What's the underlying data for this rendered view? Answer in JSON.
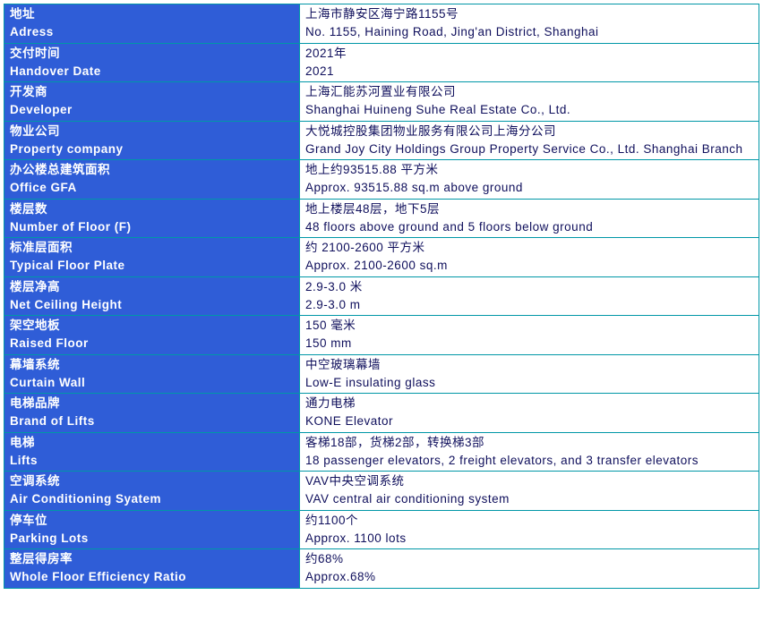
{
  "rows": [
    {
      "label_cn": "地址",
      "label_en": "Adress",
      "value_cn": "上海市静安区海宁路1155号",
      "value_en": "No. 1155, Haining Road, Jing'an District, Shanghai"
    },
    {
      "label_cn": "交付时间",
      "label_en": "Handover Date",
      "value_cn": "2021年",
      "value_en": "2021"
    },
    {
      "label_cn": "开发商",
      "label_en": "Developer",
      "value_cn": "上海汇能苏河置业有限公司",
      "value_en": "Shanghai Huineng Suhe Real Estate Co., Ltd."
    },
    {
      "label_cn": "物业公司",
      "label_en": "Property company",
      "value_cn": "大悦城控股集团物业服务有限公司上海分公司",
      "value_en": "Grand Joy City Holdings Group Property Service Co., Ltd. Shanghai Branch"
    },
    {
      "label_cn": "办公楼总建筑面积",
      "label_en": "Office GFA",
      "value_cn": "地上约93515.88 平方米",
      "value_en": "Approx. 93515.88 sq.m above ground"
    },
    {
      "label_cn": "楼层数",
      "label_en": "Number of Floor (F)",
      "value_cn": "地上楼层48层，地下5层",
      "value_en": "48 floors above ground and 5 floors below ground"
    },
    {
      "label_cn": "标准层面积",
      "label_en": "Typical Floor Plate",
      "value_cn": "约 2100-2600 平方米",
      "value_en": "Approx. 2100-2600 sq.m"
    },
    {
      "label_cn": "楼层净高",
      "label_en": "Net Ceiling Height",
      "value_cn": "2.9-3.0 米",
      "value_en": "2.9-3.0 m"
    },
    {
      "label_cn": "架空地板",
      "label_en": "Raised Floor",
      "value_cn": "150 毫米",
      "value_en": "150 mm"
    },
    {
      "label_cn": "幕墙系统",
      "label_en": "Curtain Wall",
      "value_cn": "中空玻璃幕墙",
      "value_en": "Low-E insulating glass"
    },
    {
      "label_cn": "电梯品牌",
      "label_en": "Brand of Lifts",
      "value_cn": "通力电梯",
      "value_en": "KONE Elevator"
    },
    {
      "label_cn": "电梯",
      "label_en": "Lifts",
      "value_cn": "客梯18部，货梯2部，转换梯3部",
      "value_en": "18 passenger elevators, 2 freight elevators, and 3 transfer elevators"
    },
    {
      "label_cn": "空调系统",
      "label_en": "Air Conditioning Syatem",
      "value_cn": "VAV中央空调系统",
      "value_en": "VAV central air conditioning system"
    },
    {
      "label_cn": "停车位",
      "label_en": "Parking Lots",
      "value_cn": "约1100个",
      "value_en": "Approx. 1100 lots"
    },
    {
      "label_cn": "整层得房率",
      "label_en": "Whole Floor Efficiency Ratio",
      "value_cn": "约68%",
      "value_en": "Approx.68%"
    }
  ]
}
